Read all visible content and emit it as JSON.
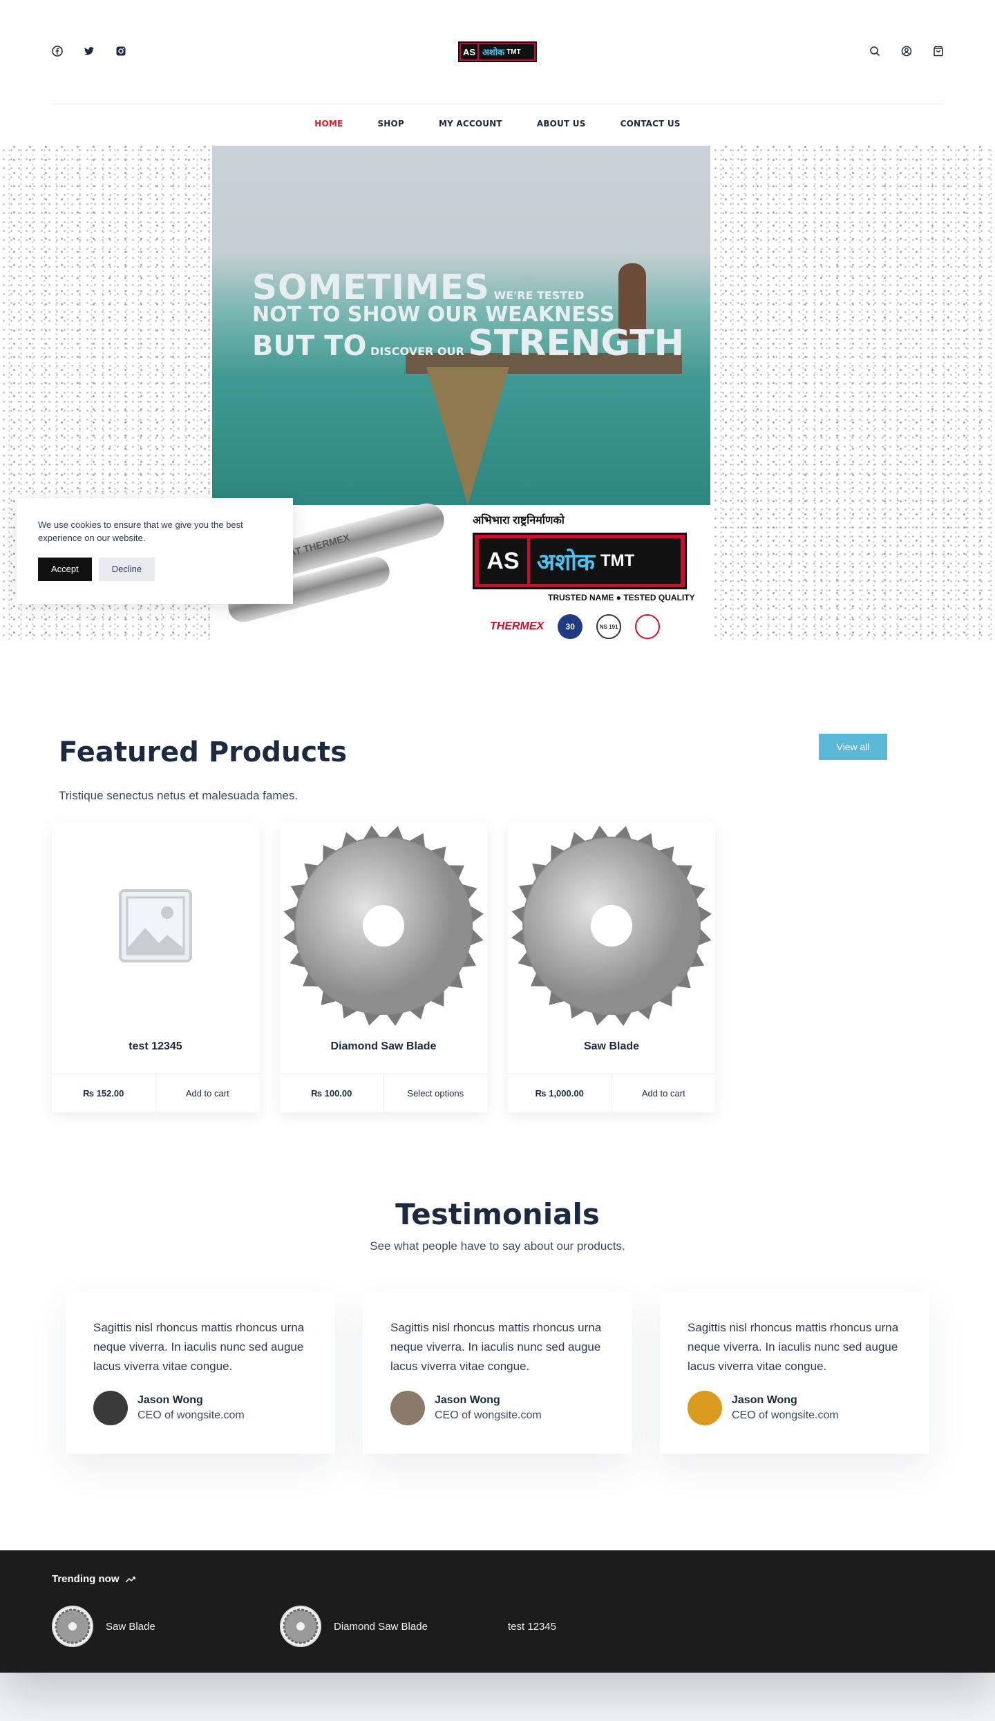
{
  "header": {
    "social": [
      "facebook-icon",
      "twitter-icon",
      "instagram-icon"
    ],
    "logo": {
      "as": "AS",
      "brand": "अशोक",
      "tmt": "TMT"
    },
    "right_icons": [
      "search-icon",
      "account-icon",
      "cart-icon"
    ]
  },
  "nav": {
    "items": [
      "HOME",
      "SHOP",
      "MY ACCOUNT",
      "ABOUT US",
      "CONTACT US"
    ]
  },
  "hero": {
    "headline_1": "SOMETIMES",
    "headline_tested": "WE'RE TESTED",
    "headline_2": "NOT TO SHOW OUR WEAKNESS",
    "headline_3a": "BUT TO",
    "headline_discover": "DISCOVER OUR",
    "headline_3b": "STRENGTH",
    "rebar_text": "AT THERMEX",
    "devanagari_line": "अभिभारा राष्ट्रनिर्माणको",
    "brand_as": "AS",
    "brand_name": "अशोक",
    "brand_tmt": "TMT",
    "tagline": "TRUSTED NAME ● TESTED QUALITY",
    "thermex": "THERMEX",
    "cert_30": "30",
    "cert_ns": "NS 191"
  },
  "cookie": {
    "text": "We use cookies to ensure that we give you the best experience on our website.",
    "accept": "Accept",
    "decline": "Decline"
  },
  "featured": {
    "title": "Featured Products",
    "subtitle": "Tristique senectus netus et malesuada fames.",
    "view_all": "View all",
    "products": [
      {
        "name": "test 12345",
        "price": "₨ 152.00",
        "action": "Add to cart",
        "image": "placeholder-icon"
      },
      {
        "name": "Diamond Saw Blade",
        "price": "₨ 100.00",
        "action": "Select options",
        "image": "saw-blade"
      },
      {
        "name": "Saw Blade",
        "price": "₨ 1,000.00",
        "action": "Add to cart",
        "image": "saw-blade"
      }
    ]
  },
  "testimonials": {
    "title": "Testimonials",
    "subtitle": "See what people have to say about our products.",
    "items": [
      {
        "quote": "Sagittis nisl rhoncus mattis rhoncus urna neque viverra. In iaculis nunc sed augue lacus viverra vitae congue.",
        "name": "Jason Wong",
        "role": "CEO of wongsite.com",
        "avatar_color": "#3a3a3a"
      },
      {
        "quote": "Sagittis nisl rhoncus mattis rhoncus urna neque viverra. In iaculis nunc sed augue lacus viverra vitae congue.",
        "name": "Jason Wong",
        "role": "CEO of wongsite.com",
        "avatar_color": "#8a7a6a"
      },
      {
        "quote": "Sagittis nisl rhoncus mattis rhoncus urna neque viverra. In iaculis nunc sed augue lacus viverra vitae congue.",
        "name": "Jason Wong",
        "role": "CEO of wongsite.com",
        "avatar_color": "#d99a1e"
      }
    ]
  },
  "footer": {
    "trending_title": "Trending now",
    "trending": [
      {
        "name": "Saw Blade",
        "thumb": true
      },
      {
        "name": "Diamond Saw Blade",
        "thumb": true
      },
      {
        "name": "test 12345",
        "thumb": false
      }
    ]
  },
  "colors": {
    "accent": "#d0202e",
    "button": "#5bb7d6",
    "navy": "#1b2a3f",
    "footer": "#1c1c1c"
  }
}
